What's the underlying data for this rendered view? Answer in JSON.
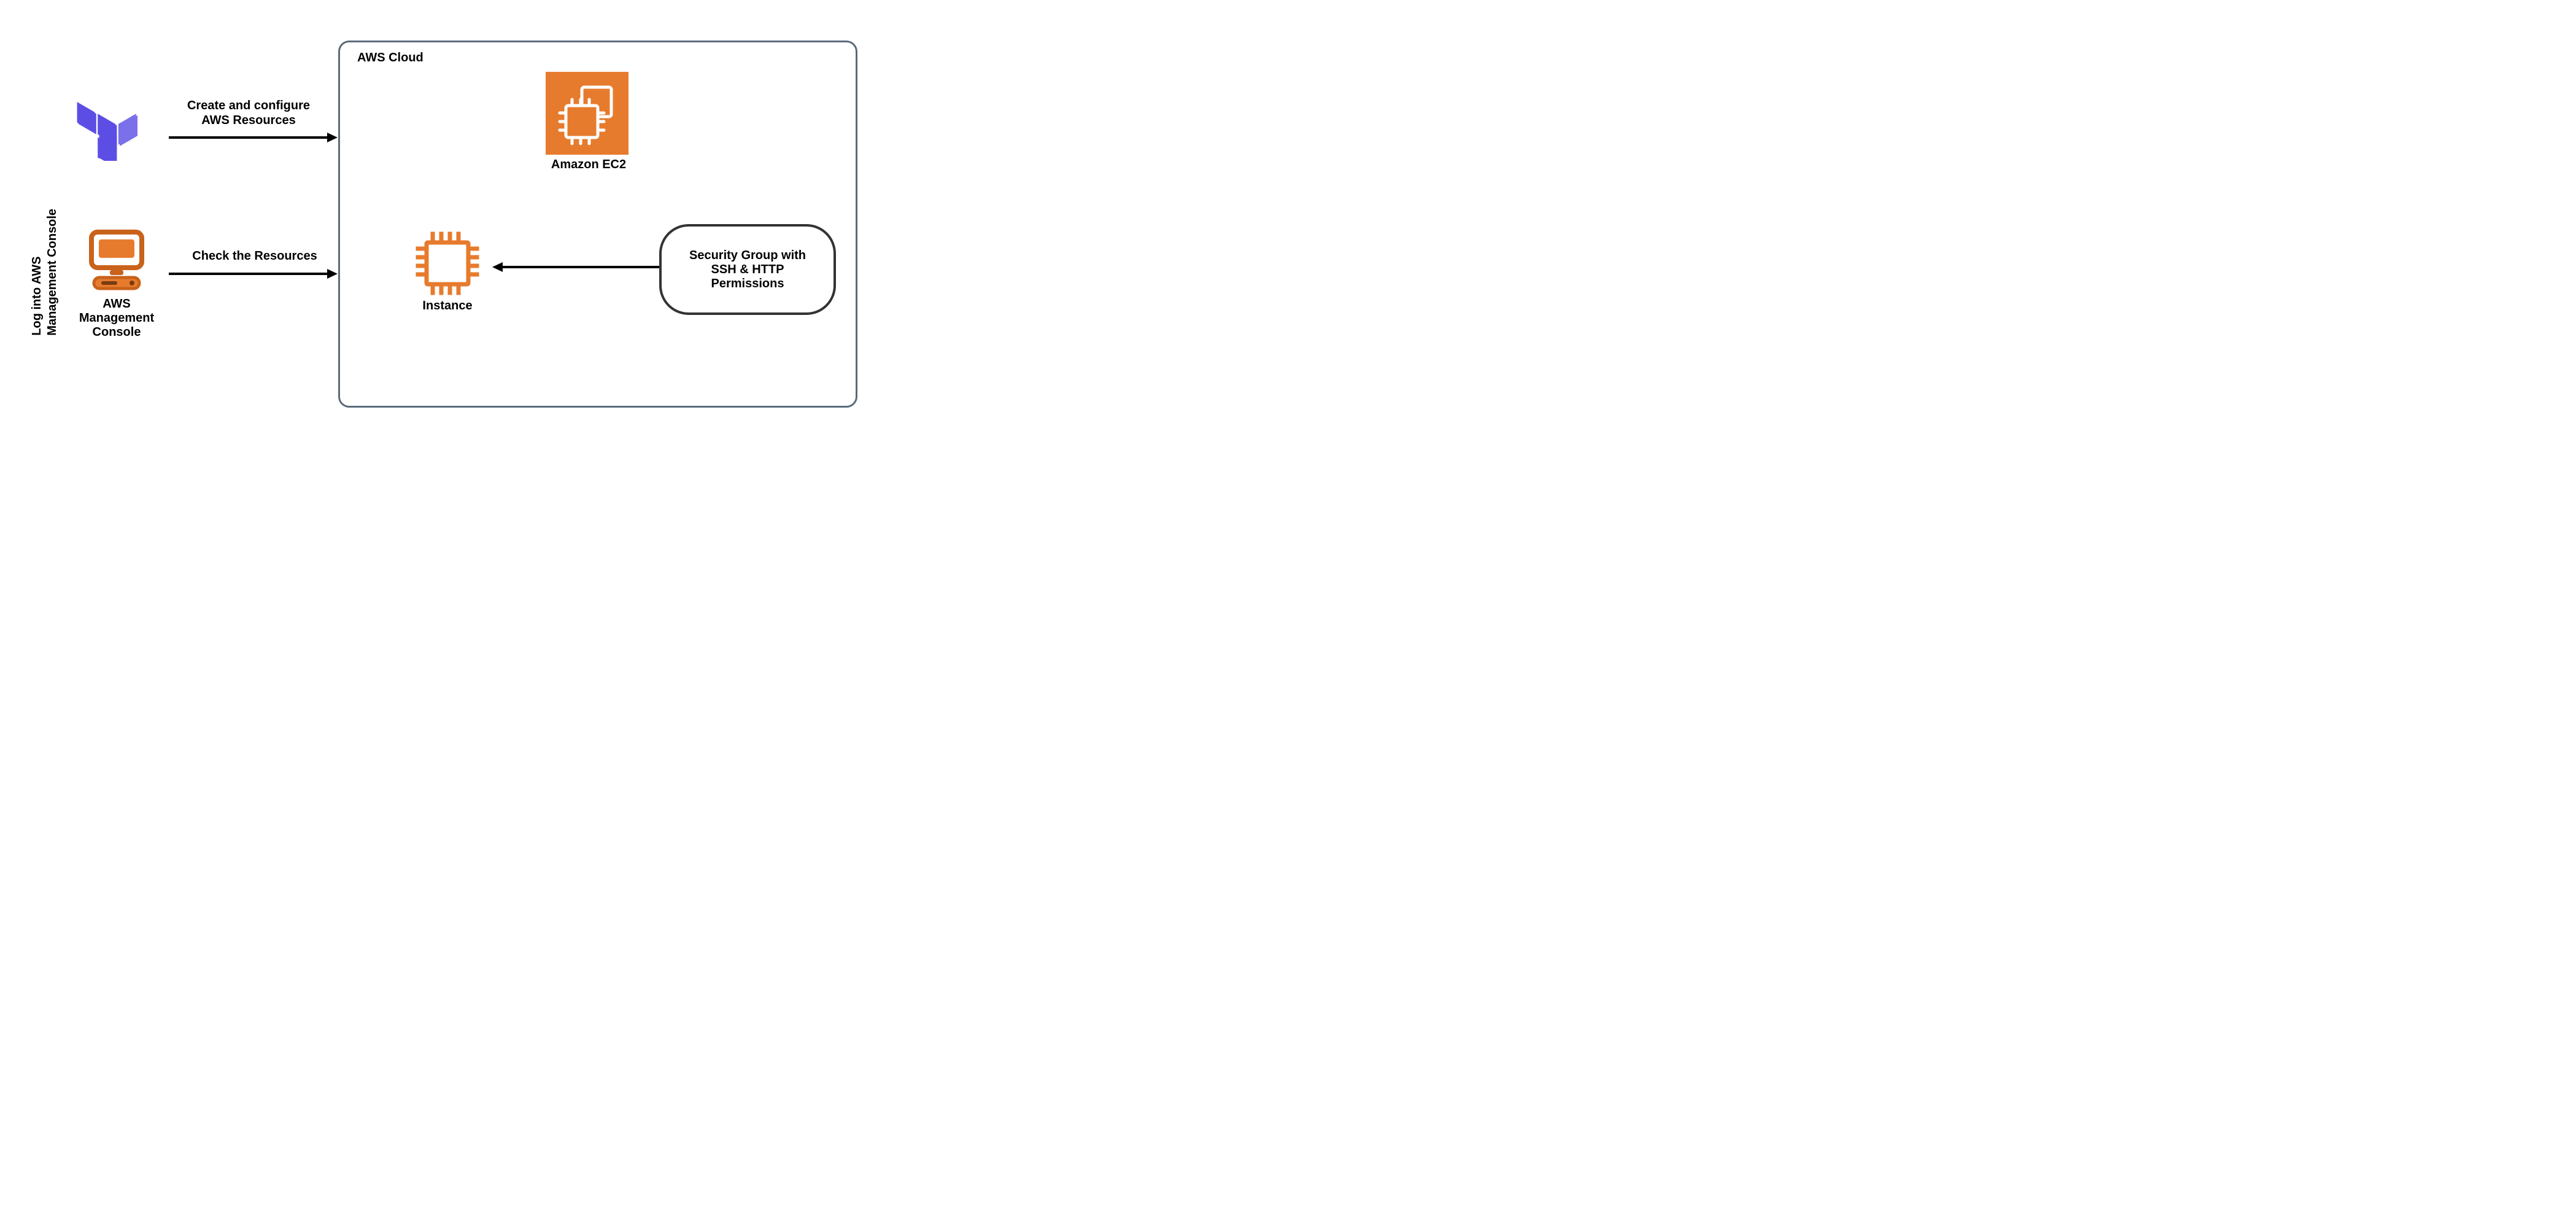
{
  "left_vertical_label_line1": "Log into AWS",
  "left_vertical_label_line2": "Management Console",
  "terraform_icon_name": "terraform-icon",
  "console_icon_name": "aws-management-console-icon",
  "console_label_line1": "AWS",
  "console_label_line2": "Management",
  "console_label_line3": "Console",
  "arrow_create_line1": "Create and configure",
  "arrow_create_line2": "AWS Resources",
  "arrow_check_label": "Check the Resources",
  "cloud_title": "AWS Cloud",
  "ec2_label": "Amazon EC2",
  "instance_label": "Instance",
  "sg_label_line1": "Security Group with",
  "sg_label_line2": "SSH & HTTP",
  "sg_label_line3": "Permissions",
  "colors": {
    "terraform_dark": "#5C4EE5",
    "terraform_light": "#7B6FEA",
    "aws_orange": "#E77B2D",
    "cloud_border": "#5A6B7B",
    "text": "#111"
  }
}
